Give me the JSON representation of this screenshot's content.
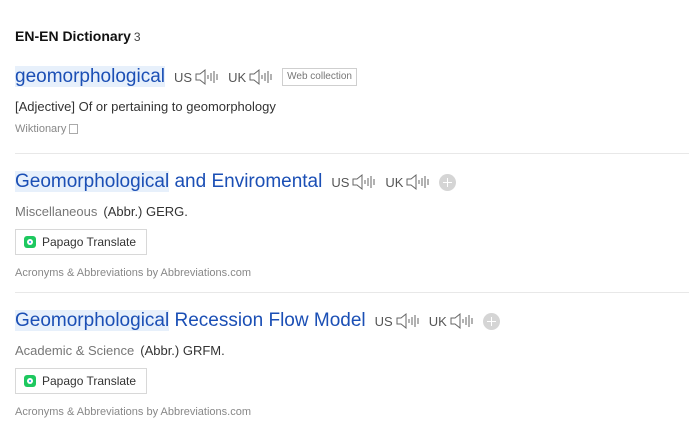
{
  "header": {
    "title": "EN-EN Dictionary",
    "count": "3"
  },
  "entries": [
    {
      "word_highlight": "geomorphological",
      "word_rest": "",
      "pron_us": "US",
      "pron_uk": "UK",
      "badge": "Web collection",
      "definition": "[Adjective] Of or pertaining to geomorphology",
      "source": "Wiktionary"
    },
    {
      "word_highlight": "Geomorphological",
      "word_rest": " and Enviromental",
      "pron_us": "US",
      "pron_uk": "UK",
      "category": "Miscellaneous",
      "abbr": "(Abbr.) GERG.",
      "translate_label": "Papago Translate",
      "attribution": "Acronyms & Abbreviations by Abbreviations.com"
    },
    {
      "word_highlight": "Geomorphological",
      "word_rest": " Recession Flow Model",
      "pron_us": "US",
      "pron_uk": "UK",
      "category": "Academic & Science",
      "abbr": "(Abbr.) GRFM.",
      "translate_label": "Papago Translate",
      "attribution": "Acronyms & Abbreviations by Abbreviations.com"
    }
  ],
  "icons": {
    "speaker": "speaker-icon",
    "add": "plus-circle-icon",
    "external": "external-link-icon",
    "papago": "papago-logo-icon"
  },
  "colors": {
    "link": "#1b4fb5",
    "highlight": "#e7f0fb",
    "papago_green": "#1ec85f"
  }
}
